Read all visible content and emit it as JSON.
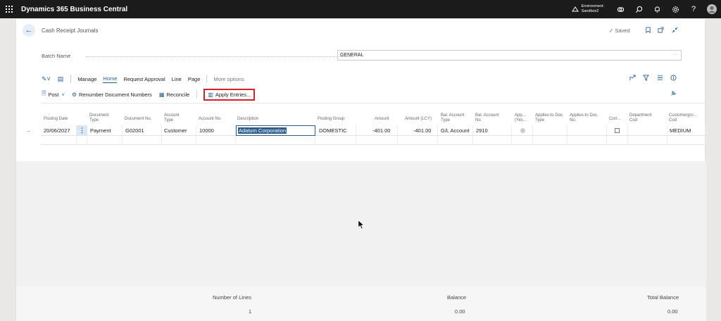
{
  "app": {
    "title": "Dynamics 365 Business Central",
    "environment_line1": "Environment:",
    "environment_line2": "Sandbox2"
  },
  "page": {
    "title": "Cash Receipt Journals",
    "saved_label": "Saved"
  },
  "batch": {
    "label": "Batch Name",
    "value": "GENERAL"
  },
  "actions": {
    "tabs": [
      "Manage",
      "Home",
      "Request Approval",
      "Line",
      "Page"
    ],
    "active_tab": "Home",
    "more_options": "More options",
    "post": "Post",
    "renumber": "Renumber Document Numbers",
    "reconcile": "Reconcile",
    "apply_entries": "Apply Entries..."
  },
  "columns": [
    "Posting Date",
    "Document Type",
    "Document No.",
    "Account Type",
    "Account No.",
    "Description",
    "Posting Group",
    "Amount",
    "Amount (LCY)",
    "Bal. Account Type",
    "Bal. Account No.",
    "App... (Yes...",
    "Applies-to Doc. Type",
    "Applies-to Doc. No.",
    "Corr...",
    "Department Cod",
    "Customergro... Cod"
  ],
  "rows": [
    {
      "posting_date": "20/06/2027",
      "document_type": "Payment",
      "document_no": "G02001",
      "account_type": "Customer",
      "account_no": "10000",
      "description": "Adatum Corporation",
      "posting_group": "DOMESTIC",
      "amount": "-401.00",
      "amount_lcy": "-401.00",
      "bal_account_type": "G/L Account",
      "bal_account_no": "2910",
      "customergroup_code": "MEDIUM"
    }
  ],
  "footer": {
    "number_of_lines_label": "Number of Lines",
    "number_of_lines_value": "1",
    "balance_label": "Balance",
    "balance_value": "0.00",
    "total_balance_label": "Total Balance",
    "total_balance_value": "0.00"
  },
  "colors": {
    "topbar": "#1b1b1b",
    "accent": "#2d5d8a",
    "highlight_border": "#d6202a"
  }
}
